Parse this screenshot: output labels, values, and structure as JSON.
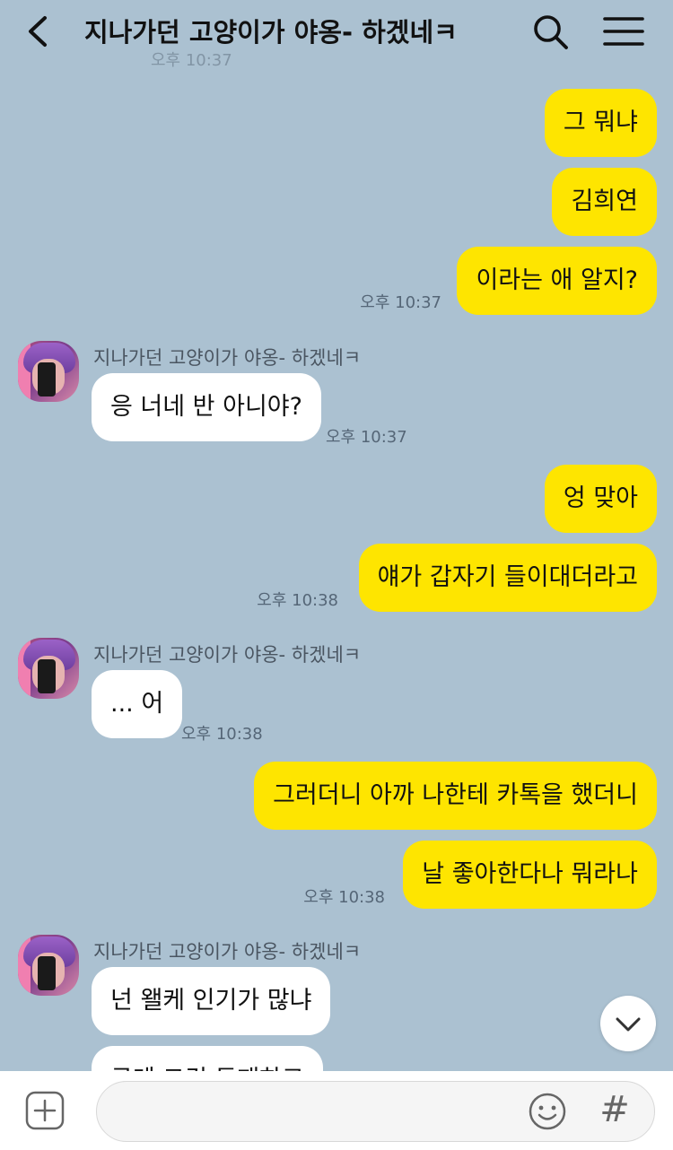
{
  "header": {
    "title": "지나가던 고양이가 야옹- 하겠네ㅋ"
  },
  "ghost_time": "오후 10:37",
  "messages": [
    {
      "text": "그 뭐냐"
    },
    {
      "text": "김희연"
    },
    {
      "text": "이라는 애 알지?",
      "time": "오후 10:37"
    },
    {
      "sender": "지나가던 고양이가 야옹- 하겠네ㅋ",
      "text": "응 너네 반 아니야?",
      "time": "오후 10:37"
    },
    {
      "text": "엉 맞아"
    },
    {
      "text": "얘가 갑자기 들이대더라고",
      "time": "오후 10:38"
    },
    {
      "sender": "지나가던 고양이가 야옹- 하겠네ㅋ",
      "text": "... 어",
      "time": "오후 10:38"
    },
    {
      "text": "그러더니 아까 나한테 카톡을 했더니"
    },
    {
      "text": "날 좋아한다나 뭐라나",
      "time": "오후 10:38"
    },
    {
      "sender": "지나가던 고양이가 야옹- 하겠네ㅋ",
      "text": "넌 왤케 인기가 많냐"
    },
    {
      "text": "근데 그건 동패하고"
    }
  ],
  "colors": {
    "background": "#abc1d1",
    "my_bubble": "#fee500",
    "their_bubble": "#ffffff"
  },
  "icons": {
    "back": "chevron-left-icon",
    "search": "search-icon",
    "menu": "hamburger-menu-icon",
    "scroll": "chevron-down-icon",
    "plus": "plus-square-icon",
    "emoji": "smiley-icon",
    "hash": "#"
  }
}
